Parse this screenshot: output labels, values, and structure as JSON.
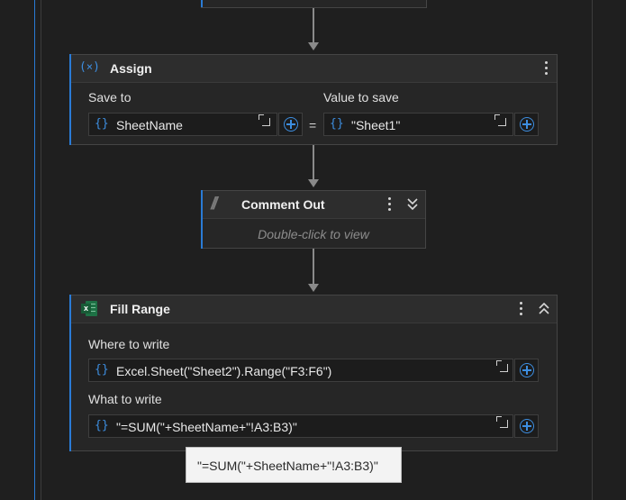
{
  "assign": {
    "title": "Assign",
    "icon": "variable-x-icon",
    "save_to_label": "Save to",
    "save_to_value": "SheetName",
    "equals": "=",
    "value_label": "Value to save",
    "value_value": "\"Sheet1\""
  },
  "comment": {
    "title": "Comment Out",
    "hint": "Double-click to view"
  },
  "fill_range": {
    "title": "Fill Range",
    "icon": "excel-icon",
    "where_label": "Where to write",
    "where_value": "Excel.Sheet(\"Sheet2\").Range(\"F3:F6\")",
    "what_label": "What to write",
    "what_value": "\"=SUM(\"+SheetName+\"!A3:B3)\""
  },
  "tooltip": {
    "text": "\"=SUM(\"+SheetName+\"!A3:B3)\""
  },
  "colors": {
    "accent": "#2a7bd6",
    "expression_brace": "#3d8ee0",
    "excel_green": "#1e7145"
  },
  "glyphs": {
    "brace": "{}",
    "comment_slashes": "//"
  }
}
